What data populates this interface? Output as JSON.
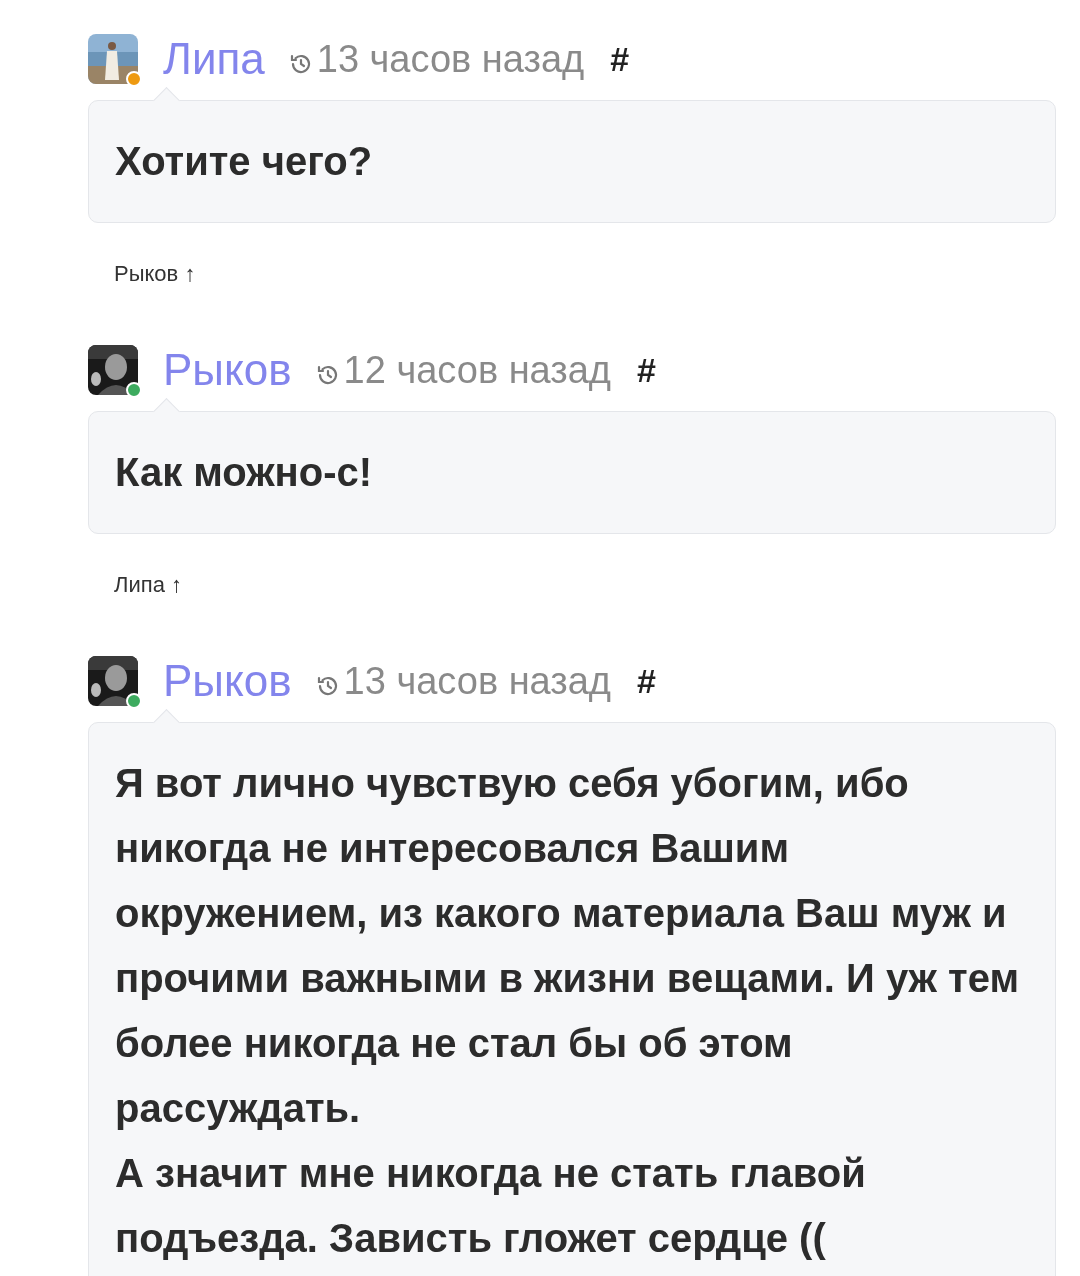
{
  "comments": [
    {
      "author": "Липа",
      "color": "#ee9a11",
      "avatar": {
        "kind": "picture"
      },
      "time": "13 часов назад",
      "anchor": "#",
      "paragraphs": [
        "Хотите чего?"
      ],
      "reply_to": "Рыков ↑"
    },
    {
      "author": "Рыков",
      "color": "#3dab5f",
      "avatar": {
        "kind": "picture"
      },
      "time": "12 часов назад",
      "anchor": "#",
      "paragraphs": [
        "Как можно-с!"
      ],
      "reply_to": "Липа ↑"
    },
    {
      "author": "Рыков",
      "color": "#3dab5f",
      "avatar": {
        "kind": "picture"
      },
      "time": "13 часов назад",
      "anchor": "#",
      "paragraphs": [
        "Я вот лично чувствую себя убогим, ибо никогда не интересовался Вашим окружением, из какого материала Ваш муж и прочими важными в жизни вещами. И уж тем более никогда не стал бы об этом рассуждать.",
        "А значит мне никогда не стать главой подъезда. Зависть гложет сердце (("
      ]
    }
  ]
}
